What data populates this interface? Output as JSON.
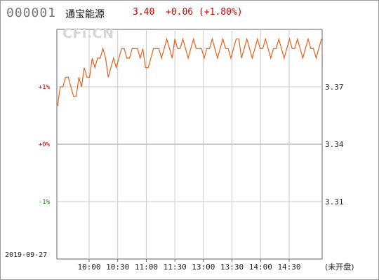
{
  "header": {
    "code": "000001",
    "name": "通宝能源",
    "price": "3.40",
    "change": "+0.06",
    "change_pct": "(+1.80%)"
  },
  "watermark": "CFi.CN",
  "date": "2019-09-27",
  "status": "(未开盘)",
  "colors": {
    "up": "#cc0000",
    "down": "#008000",
    "line": "#e8601c",
    "grid": "#c8c8c8",
    "axis": "#666666"
  },
  "chart_data": {
    "type": "line",
    "prev_close": 3.34,
    "ylim": [
      3.28,
      3.4
    ],
    "grid": true,
    "pct_ticks": [
      {
        "label": "+1%",
        "value": 3.37,
        "color": "up"
      },
      {
        "label": "+0%",
        "value": 3.34,
        "color": "up"
      },
      {
        "label": "-1%",
        "value": 3.31,
        "color": "down"
      }
    ],
    "price_ticks": [
      {
        "label": "3.37",
        "value": 3.37
      },
      {
        "label": "3.34",
        "value": 3.34
      },
      {
        "label": "3.31",
        "value": 3.31
      }
    ],
    "x_ticks": [
      "10:00",
      "10:30",
      "11:00",
      "11:30",
      "13:00",
      "13:30",
      "14:00",
      "14:30"
    ],
    "series": [
      {
        "values": [
          3.36,
          3.37,
          3.37,
          3.375,
          3.375,
          3.37,
          3.365,
          3.365,
          3.375,
          3.37,
          3.38,
          3.375,
          3.375,
          3.385,
          3.38,
          3.385,
          3.385,
          3.39,
          3.385,
          3.375,
          3.38,
          3.385,
          3.38,
          3.385,
          3.39,
          3.39,
          3.385,
          3.385,
          3.39,
          3.39,
          3.39,
          3.385,
          3.39,
          3.38,
          3.38,
          3.385,
          3.39,
          3.39,
          3.39,
          3.385,
          3.39,
          3.395,
          3.39,
          3.385,
          3.395,
          3.39,
          3.39,
          3.395,
          3.39,
          3.385,
          3.39,
          3.395,
          3.39,
          3.39,
          3.39,
          3.385,
          3.39,
          3.39,
          3.395,
          3.39,
          3.385,
          3.39,
          3.395,
          3.39,
          3.39,
          3.385,
          3.39,
          3.395,
          3.395,
          3.385,
          3.39,
          3.395,
          3.39,
          3.385,
          3.39,
          3.395,
          3.39,
          3.39,
          3.395,
          3.39,
          3.385,
          3.39,
          3.39,
          3.395,
          3.39,
          3.385,
          3.39,
          3.395,
          3.39,
          3.39,
          3.395,
          3.39,
          3.385,
          3.39,
          3.395,
          3.39,
          3.39,
          3.385,
          3.39,
          3.395
        ]
      }
    ]
  }
}
